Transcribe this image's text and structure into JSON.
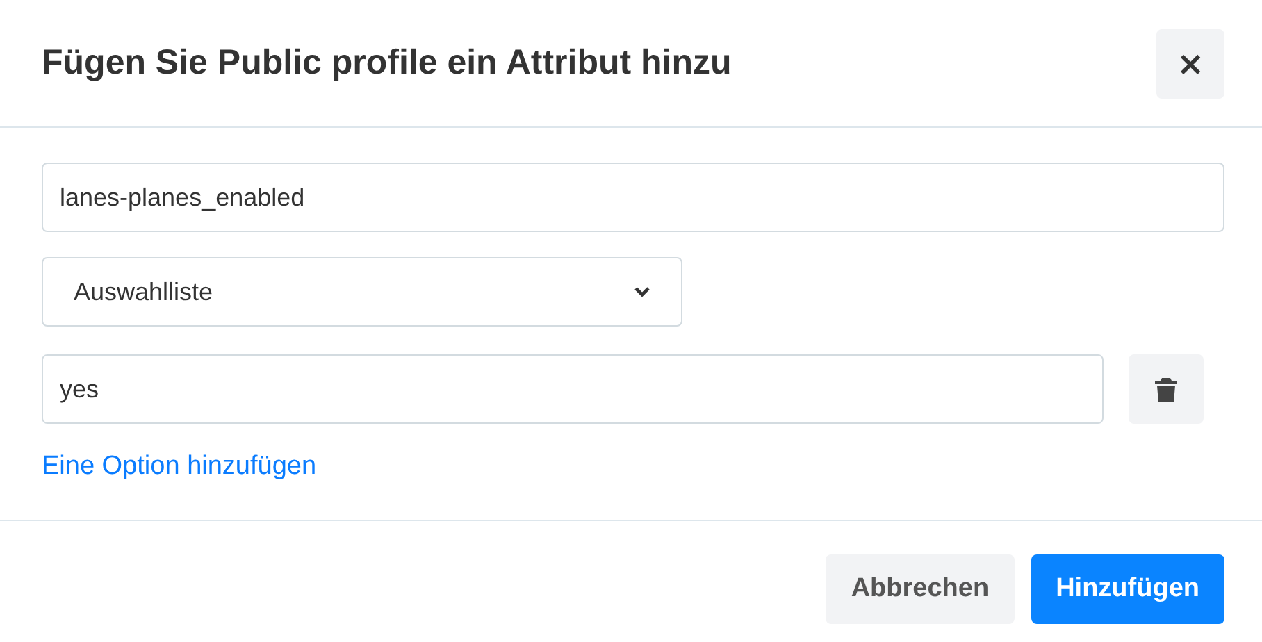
{
  "dialog": {
    "title": "Fügen Sie Public profile ein Attribut hinzu",
    "close_label": "×"
  },
  "name_field": {
    "value": "lanes-planes_enabled"
  },
  "type_select": {
    "value": "Auswahlliste"
  },
  "options": [
    {
      "value": "yes"
    }
  ],
  "add_option_link": "Eine Option hinzufügen",
  "buttons": [
    {
      "label": "Abbrechen",
      "kind": "secondary"
    },
    {
      "label": "Hinzufügen",
      "kind": "primary"
    }
  ]
}
